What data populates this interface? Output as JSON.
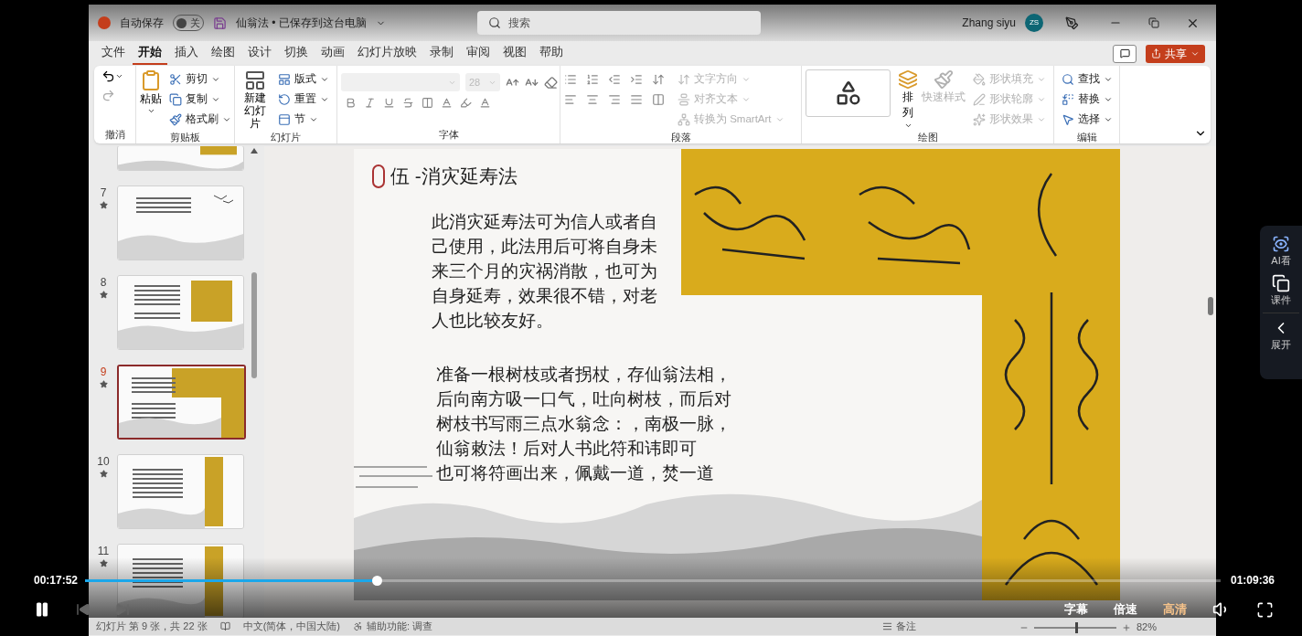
{
  "title_bar": {
    "autosave_label": "自动保存",
    "autosave": {
      "on": false,
      "label": "关"
    },
    "document_title": "仙翁法 • 已保存到这台电脑",
    "search": {
      "placeholder": "搜索"
    },
    "user_name": "Zhang siyu",
    "avatar_initials": "ZS"
  },
  "ribbon_tabs": [
    {
      "label": "文件",
      "selected": false
    },
    {
      "label": "开始",
      "selected": true
    },
    {
      "label": "插入",
      "selected": false
    },
    {
      "label": "绘图",
      "selected": false
    },
    {
      "label": "设计",
      "selected": false
    },
    {
      "label": "切换",
      "selected": false
    },
    {
      "label": "动画",
      "selected": false
    },
    {
      "label": "幻灯片放映",
      "selected": false
    },
    {
      "label": "录制",
      "selected": false
    },
    {
      "label": "审阅",
      "selected": false
    },
    {
      "label": "视图",
      "selected": false
    },
    {
      "label": "帮助",
      "selected": false
    }
  ],
  "share_button": "共享",
  "ribbon": {
    "undo": {
      "label": "撤消"
    },
    "clipboard": {
      "label": "剪贴板",
      "paste": "粘贴",
      "items": [
        {
          "label": "剪切",
          "kind": "cut"
        },
        {
          "label": "复制",
          "kind": "copy"
        },
        {
          "label": "格式刷",
          "kind": "format"
        }
      ]
    },
    "slides": {
      "label": "幻灯片",
      "new_slide": [
        "新建",
        "幻灯片"
      ],
      "items": [
        {
          "label": "版式",
          "kind": "layout"
        },
        {
          "label": "重置",
          "kind": "reset"
        },
        {
          "label": "节",
          "kind": "section"
        }
      ]
    },
    "font": {
      "label": "字体",
      "font_size": "28",
      "disabled": true
    },
    "paragraph": {
      "label": "段落",
      "items": [
        {
          "label": "文字方向",
          "kind": "direction",
          "disabled": true
        },
        {
          "label": "对齐文本",
          "kind": "align",
          "disabled": true
        },
        {
          "label": "转换为 SmartArt",
          "kind": "smartart",
          "disabled": true
        }
      ]
    },
    "drawing": {
      "label": "绘图",
      "arrange": "排列",
      "quick_styles": {
        "label": "快速样式",
        "disabled": true
      },
      "items": [
        {
          "label": "形状填充",
          "kind": "fill",
          "disabled": true
        },
        {
          "label": "形状轮廓",
          "kind": "outline",
          "disabled": true
        },
        {
          "label": "形状效果",
          "kind": "effect",
          "disabled": true
        }
      ]
    },
    "editing": {
      "label": "编辑",
      "items": [
        {
          "label": "查找",
          "kind": "find"
        },
        {
          "label": "替换",
          "kind": "replace"
        },
        {
          "label": "选择",
          "kind": "select"
        }
      ]
    }
  },
  "thumbnails": [
    {
      "kind": "partial",
      "selected": false
    },
    {
      "number": "7",
      "kind": "text",
      "selected": false
    },
    {
      "number": "8",
      "kind": "image",
      "selected": false
    },
    {
      "number": "9",
      "kind": "talisman",
      "selected": true
    },
    {
      "number": "10",
      "kind": "strip",
      "selected": false
    },
    {
      "number": "11",
      "kind": "strip",
      "selected": false
    }
  ],
  "slide": {
    "title": "伍 -消灾延寿法",
    "paragraphs": [
      [
        "此消灾延寿法可为信人或者自",
        "己使用，此法用后可将自身未",
        "来三个月的灾祸消散，也可为",
        "自身延寿，效果很不错，对老",
        "人也比较友好。"
      ],
      [
        "准备一根树枝或者拐杖，存仙翁法相，",
        "后向南方吸一口气，吐向树枝，而后对",
        "树枝书写雨三点水翁念：，南极一脉，",
        "仙翁敕法！后对人书此符和讳即可",
        "也可将符画出来，佩戴一道，焚一道"
      ]
    ]
  },
  "status_bar": {
    "slide_info": "幻灯片 第 9 张，共 22 张",
    "language": "中文(简体，中国大陆)",
    "accessibility": "辅助功能: 调查",
    "notes": "备注",
    "zoom": {
      "level": 0.5,
      "reading": "82%"
    }
  },
  "player": {
    "current_time": "00:17:52",
    "total_time": "01:09:36",
    "progress": {
      "level": 0.257
    },
    "prev_disabled": true,
    "next_disabled": true,
    "options": [
      {
        "label": "字幕",
        "selected": false
      },
      {
        "label": "倍速",
        "selected": false
      },
      {
        "label": "高清",
        "selected": true
      }
    ]
  },
  "side_panel": [
    {
      "label": "AI看",
      "kind": "ai"
    },
    {
      "label": "课件",
      "kind": "courseware"
    },
    {
      "label": "展开",
      "kind": "expand"
    }
  ]
}
